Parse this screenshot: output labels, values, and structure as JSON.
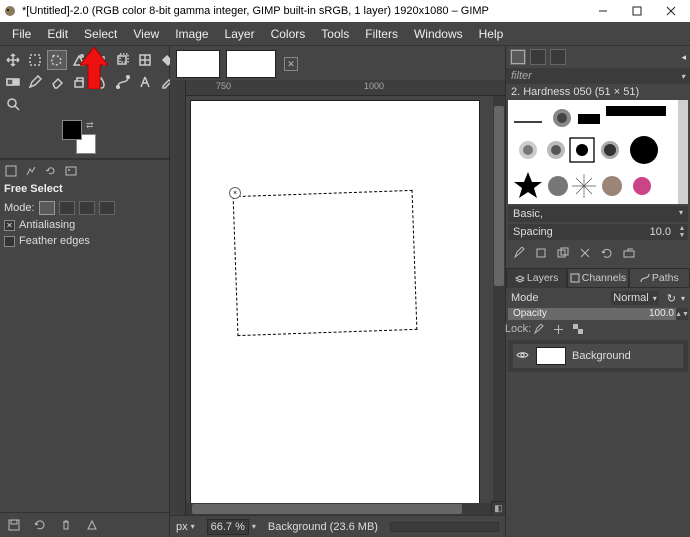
{
  "titlebar": {
    "title": "*[Untitled]-2.0 (RGB color 8-bit gamma integer, GIMP built-in sRGB, 1 layer) 1920x1080 – GIMP"
  },
  "menu": {
    "file": "File",
    "edit": "Edit",
    "select": "Select",
    "view": "View",
    "image": "Image",
    "layer": "Layer",
    "colors": "Colors",
    "tools": "Tools",
    "filters": "Filters",
    "windows": "Windows",
    "help": "Help"
  },
  "ruler": {
    "t1": "750",
    "t2": "1000"
  },
  "tool_options": {
    "title": "Free Select",
    "mode_label": "Mode:",
    "antialias": "Antialiasing",
    "feather": "Feather edges"
  },
  "statusbar": {
    "unit": "px",
    "zoom": "66.7 %",
    "msg": "Background (23.6 MB)"
  },
  "brushpanel": {
    "filter": "filter",
    "name": "2. Hardness 050 (51 × 51)",
    "preset": "Basic,",
    "spacing_label": "Spacing",
    "spacing_value": "10.0"
  },
  "layerspanel": {
    "tab_layers": "Layers",
    "tab_channels": "Channels",
    "tab_paths": "Paths",
    "mode_label": "Mode",
    "mode_value": "Normal",
    "opacity_label": "Opacity",
    "opacity_value": "100.0",
    "lock_label": "Lock:",
    "layer_name": "Background"
  }
}
